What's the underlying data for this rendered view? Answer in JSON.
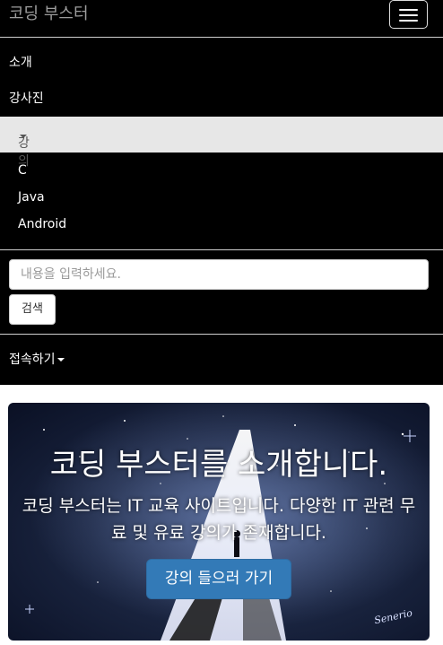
{
  "navbar": {
    "brand": "코딩 부스터",
    "menu_items": [
      {
        "label": "소개"
      },
      {
        "label": "강사진"
      }
    ],
    "dropdown": {
      "label": "강의",
      "items": [
        "C",
        "Java",
        "Android"
      ]
    },
    "search": {
      "placeholder": "내용을 입력하세요.",
      "button_label": "검색"
    },
    "account_label": "접속하기"
  },
  "jumbotron": {
    "title": "코딩 부스터를 소개합니다.",
    "text": "코딩 부스터는 IT 교육 사이트입니다. 다양한 IT 관련 무료 및 유료 강의가 존재합니다.",
    "button_label": "강의 들으러 가기",
    "signature": "Senerio"
  },
  "colors": {
    "navbar_bg": "#000000",
    "active_bg": "#e7e7e7",
    "primary_button": "#337ab7"
  },
  "icons": [
    "hamburger-icon",
    "caret-down-icon"
  ]
}
